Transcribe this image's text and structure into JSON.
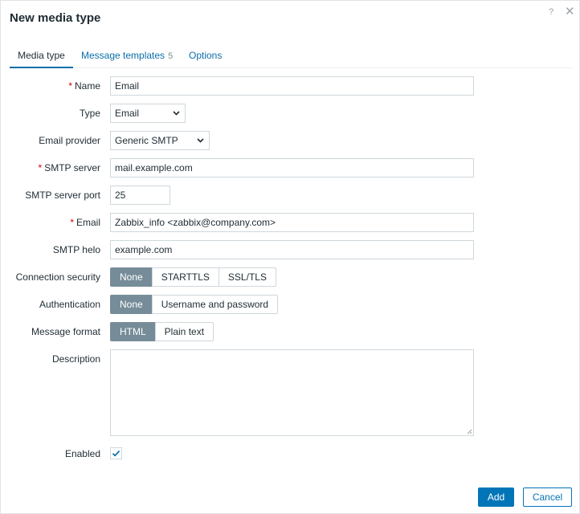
{
  "dialog": {
    "title": "New media type",
    "help_icon": "?",
    "close_icon": "✕"
  },
  "tabs": [
    {
      "label": "Media type",
      "active": true
    },
    {
      "label": "Message templates",
      "count": "5",
      "active": false
    },
    {
      "label": "Options",
      "active": false
    }
  ],
  "form": {
    "name": {
      "label": "Name",
      "required": true,
      "value": "Email"
    },
    "type": {
      "label": "Type",
      "selected": "Email"
    },
    "email_provider": {
      "label": "Email provider",
      "selected": "Generic SMTP"
    },
    "smtp_server": {
      "label": "SMTP server",
      "required": true,
      "value": "mail.example.com"
    },
    "smtp_server_port": {
      "label": "SMTP server port",
      "value": "25"
    },
    "email": {
      "label": "Email",
      "required": true,
      "value": "Zabbix_info <zabbix@company.com>"
    },
    "smtp_helo": {
      "label": "SMTP helo",
      "value": "example.com"
    },
    "connection_security": {
      "label": "Connection security",
      "options": [
        "None",
        "STARTTLS",
        "SSL/TLS"
      ],
      "selected": "None"
    },
    "authentication": {
      "label": "Authentication",
      "options": [
        "None",
        "Username and password"
      ],
      "selected": "None"
    },
    "message_format": {
      "label": "Message format",
      "options": [
        "HTML",
        "Plain text"
      ],
      "selected": "HTML"
    },
    "description": {
      "label": "Description",
      "value": ""
    },
    "enabled": {
      "label": "Enabled",
      "checked": true
    }
  },
  "buttons": {
    "add": "Add",
    "cancel": "Cancel"
  },
  "colors": {
    "link": "#0b6ea8",
    "primary": "#0275b8",
    "segment_selected": "#768d99",
    "required": "#d40000"
  }
}
